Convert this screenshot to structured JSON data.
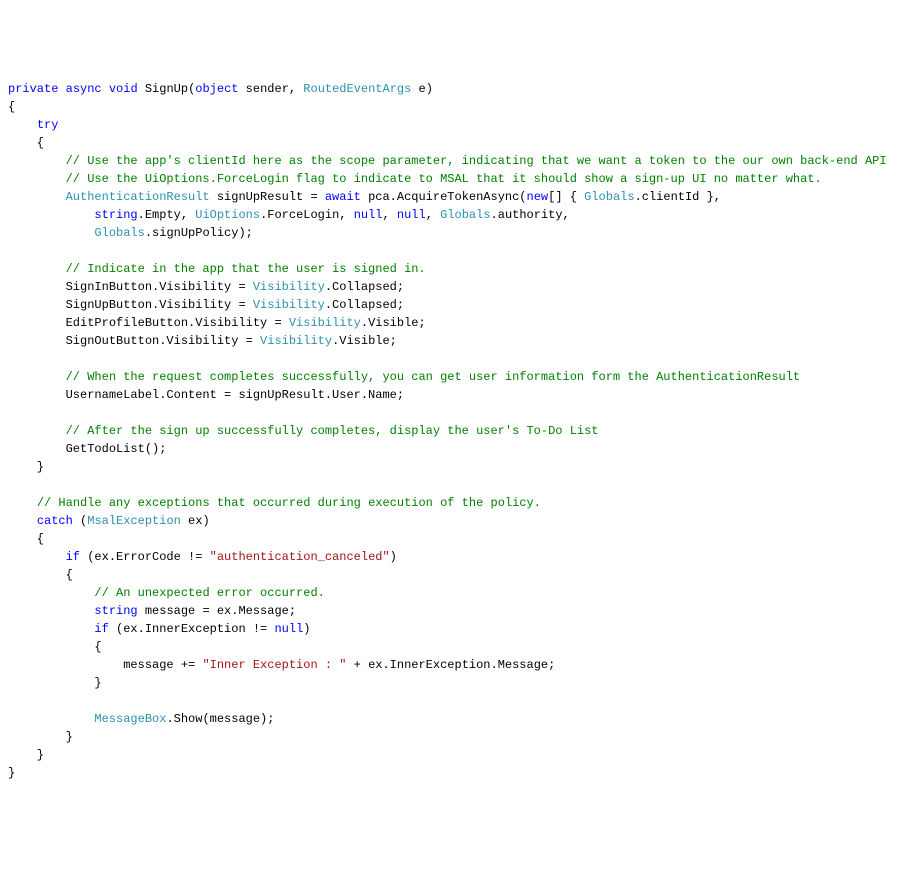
{
  "code": {
    "tokens": [
      {
        "kind": "kw",
        "t": "private"
      },
      {
        "kind": "plain",
        "t": " "
      },
      {
        "kind": "kw",
        "t": "async"
      },
      {
        "kind": "plain",
        "t": " "
      },
      {
        "kind": "kw",
        "t": "void"
      },
      {
        "kind": "plain",
        "t": " SignUp("
      },
      {
        "kind": "kw",
        "t": "object"
      },
      {
        "kind": "plain",
        "t": " sender, "
      },
      {
        "kind": "type",
        "t": "RoutedEventArgs"
      },
      {
        "kind": "plain",
        "t": " e)\n"
      },
      {
        "kind": "plain",
        "t": "{\n"
      },
      {
        "kind": "plain",
        "t": "    "
      },
      {
        "kind": "kw",
        "t": "try"
      },
      {
        "kind": "plain",
        "t": "\n"
      },
      {
        "kind": "plain",
        "t": "    {\n"
      },
      {
        "kind": "plain",
        "t": "        "
      },
      {
        "kind": "comment",
        "t": "// Use the app's clientId here as the scope parameter, indicating that we want a token to the our own back-end API"
      },
      {
        "kind": "plain",
        "t": "\n"
      },
      {
        "kind": "plain",
        "t": "        "
      },
      {
        "kind": "comment",
        "t": "// Use the UiOptions.ForceLogin flag to indicate to MSAL that it should show a sign-up UI no matter what."
      },
      {
        "kind": "plain",
        "t": "\n"
      },
      {
        "kind": "plain",
        "t": "        "
      },
      {
        "kind": "type",
        "t": "AuthenticationResult"
      },
      {
        "kind": "plain",
        "t": " signUpResult = "
      },
      {
        "kind": "kw",
        "t": "await"
      },
      {
        "kind": "plain",
        "t": " pca.AcquireTokenAsync("
      },
      {
        "kind": "kw",
        "t": "new"
      },
      {
        "kind": "plain",
        "t": "[] { "
      },
      {
        "kind": "type",
        "t": "Globals"
      },
      {
        "kind": "plain",
        "t": ".clientId },\n"
      },
      {
        "kind": "plain",
        "t": "            "
      },
      {
        "kind": "kw",
        "t": "string"
      },
      {
        "kind": "plain",
        "t": ".Empty, "
      },
      {
        "kind": "type",
        "t": "UiOptions"
      },
      {
        "kind": "plain",
        "t": ".ForceLogin, "
      },
      {
        "kind": "kw",
        "t": "null"
      },
      {
        "kind": "plain",
        "t": ", "
      },
      {
        "kind": "kw",
        "t": "null"
      },
      {
        "kind": "plain",
        "t": ", "
      },
      {
        "kind": "type",
        "t": "Globals"
      },
      {
        "kind": "plain",
        "t": ".authority,\n"
      },
      {
        "kind": "plain",
        "t": "            "
      },
      {
        "kind": "type",
        "t": "Globals"
      },
      {
        "kind": "plain",
        "t": ".signUpPolicy);\n"
      },
      {
        "kind": "plain",
        "t": "\n"
      },
      {
        "kind": "plain",
        "t": "        "
      },
      {
        "kind": "comment",
        "t": "// Indicate in the app that the user is signed in."
      },
      {
        "kind": "plain",
        "t": "\n"
      },
      {
        "kind": "plain",
        "t": "        SignInButton.Visibility = "
      },
      {
        "kind": "type",
        "t": "Visibility"
      },
      {
        "kind": "plain",
        "t": ".Collapsed;\n"
      },
      {
        "kind": "plain",
        "t": "        SignUpButton.Visibility = "
      },
      {
        "kind": "type",
        "t": "Visibility"
      },
      {
        "kind": "plain",
        "t": ".Collapsed;\n"
      },
      {
        "kind": "plain",
        "t": "        EditProfileButton.Visibility = "
      },
      {
        "kind": "type",
        "t": "Visibility"
      },
      {
        "kind": "plain",
        "t": ".Visible;\n"
      },
      {
        "kind": "plain",
        "t": "        SignOutButton.Visibility = "
      },
      {
        "kind": "type",
        "t": "Visibility"
      },
      {
        "kind": "plain",
        "t": ".Visible;\n"
      },
      {
        "kind": "plain",
        "t": "\n"
      },
      {
        "kind": "plain",
        "t": "        "
      },
      {
        "kind": "comment",
        "t": "// When the request completes successfully, you can get user information form the AuthenticationResult"
      },
      {
        "kind": "plain",
        "t": "\n"
      },
      {
        "kind": "plain",
        "t": "        UsernameLabel.Content = signUpResult.User.Name;\n"
      },
      {
        "kind": "plain",
        "t": "\n"
      },
      {
        "kind": "plain",
        "t": "        "
      },
      {
        "kind": "comment",
        "t": "// After the sign up successfully completes, display the user's To-Do List"
      },
      {
        "kind": "plain",
        "t": "\n"
      },
      {
        "kind": "plain",
        "t": "        GetTodoList();\n"
      },
      {
        "kind": "plain",
        "t": "    }\n"
      },
      {
        "kind": "plain",
        "t": "\n"
      },
      {
        "kind": "plain",
        "t": "    "
      },
      {
        "kind": "comment",
        "t": "// Handle any exceptions that occurred during execution of the policy."
      },
      {
        "kind": "plain",
        "t": "\n"
      },
      {
        "kind": "plain",
        "t": "    "
      },
      {
        "kind": "kw",
        "t": "catch"
      },
      {
        "kind": "plain",
        "t": " ("
      },
      {
        "kind": "type",
        "t": "MsalException"
      },
      {
        "kind": "plain",
        "t": " ex)\n"
      },
      {
        "kind": "plain",
        "t": "    {\n"
      },
      {
        "kind": "plain",
        "t": "        "
      },
      {
        "kind": "kw",
        "t": "if"
      },
      {
        "kind": "plain",
        "t": " (ex.ErrorCode != "
      },
      {
        "kind": "str",
        "t": "\"authentication_canceled\""
      },
      {
        "kind": "plain",
        "t": ")\n"
      },
      {
        "kind": "plain",
        "t": "        {\n"
      },
      {
        "kind": "plain",
        "t": "            "
      },
      {
        "kind": "comment",
        "t": "// An unexpected error occurred."
      },
      {
        "kind": "plain",
        "t": "\n"
      },
      {
        "kind": "plain",
        "t": "            "
      },
      {
        "kind": "kw",
        "t": "string"
      },
      {
        "kind": "plain",
        "t": " message = ex.Message;\n"
      },
      {
        "kind": "plain",
        "t": "            "
      },
      {
        "kind": "kw",
        "t": "if"
      },
      {
        "kind": "plain",
        "t": " (ex.InnerException != "
      },
      {
        "kind": "kw",
        "t": "null"
      },
      {
        "kind": "plain",
        "t": ")\n"
      },
      {
        "kind": "plain",
        "t": "            {\n"
      },
      {
        "kind": "plain",
        "t": "                message += "
      },
      {
        "kind": "str",
        "t": "\"Inner Exception : \""
      },
      {
        "kind": "plain",
        "t": " + ex.InnerException.Message;\n"
      },
      {
        "kind": "plain",
        "t": "            }\n"
      },
      {
        "kind": "plain",
        "t": "\n"
      },
      {
        "kind": "plain",
        "t": "            "
      },
      {
        "kind": "type",
        "t": "MessageBox"
      },
      {
        "kind": "plain",
        "t": ".Show(message);\n"
      },
      {
        "kind": "plain",
        "t": "        }\n"
      },
      {
        "kind": "plain",
        "t": "    }\n"
      },
      {
        "kind": "plain",
        "t": "}\n"
      }
    ]
  }
}
